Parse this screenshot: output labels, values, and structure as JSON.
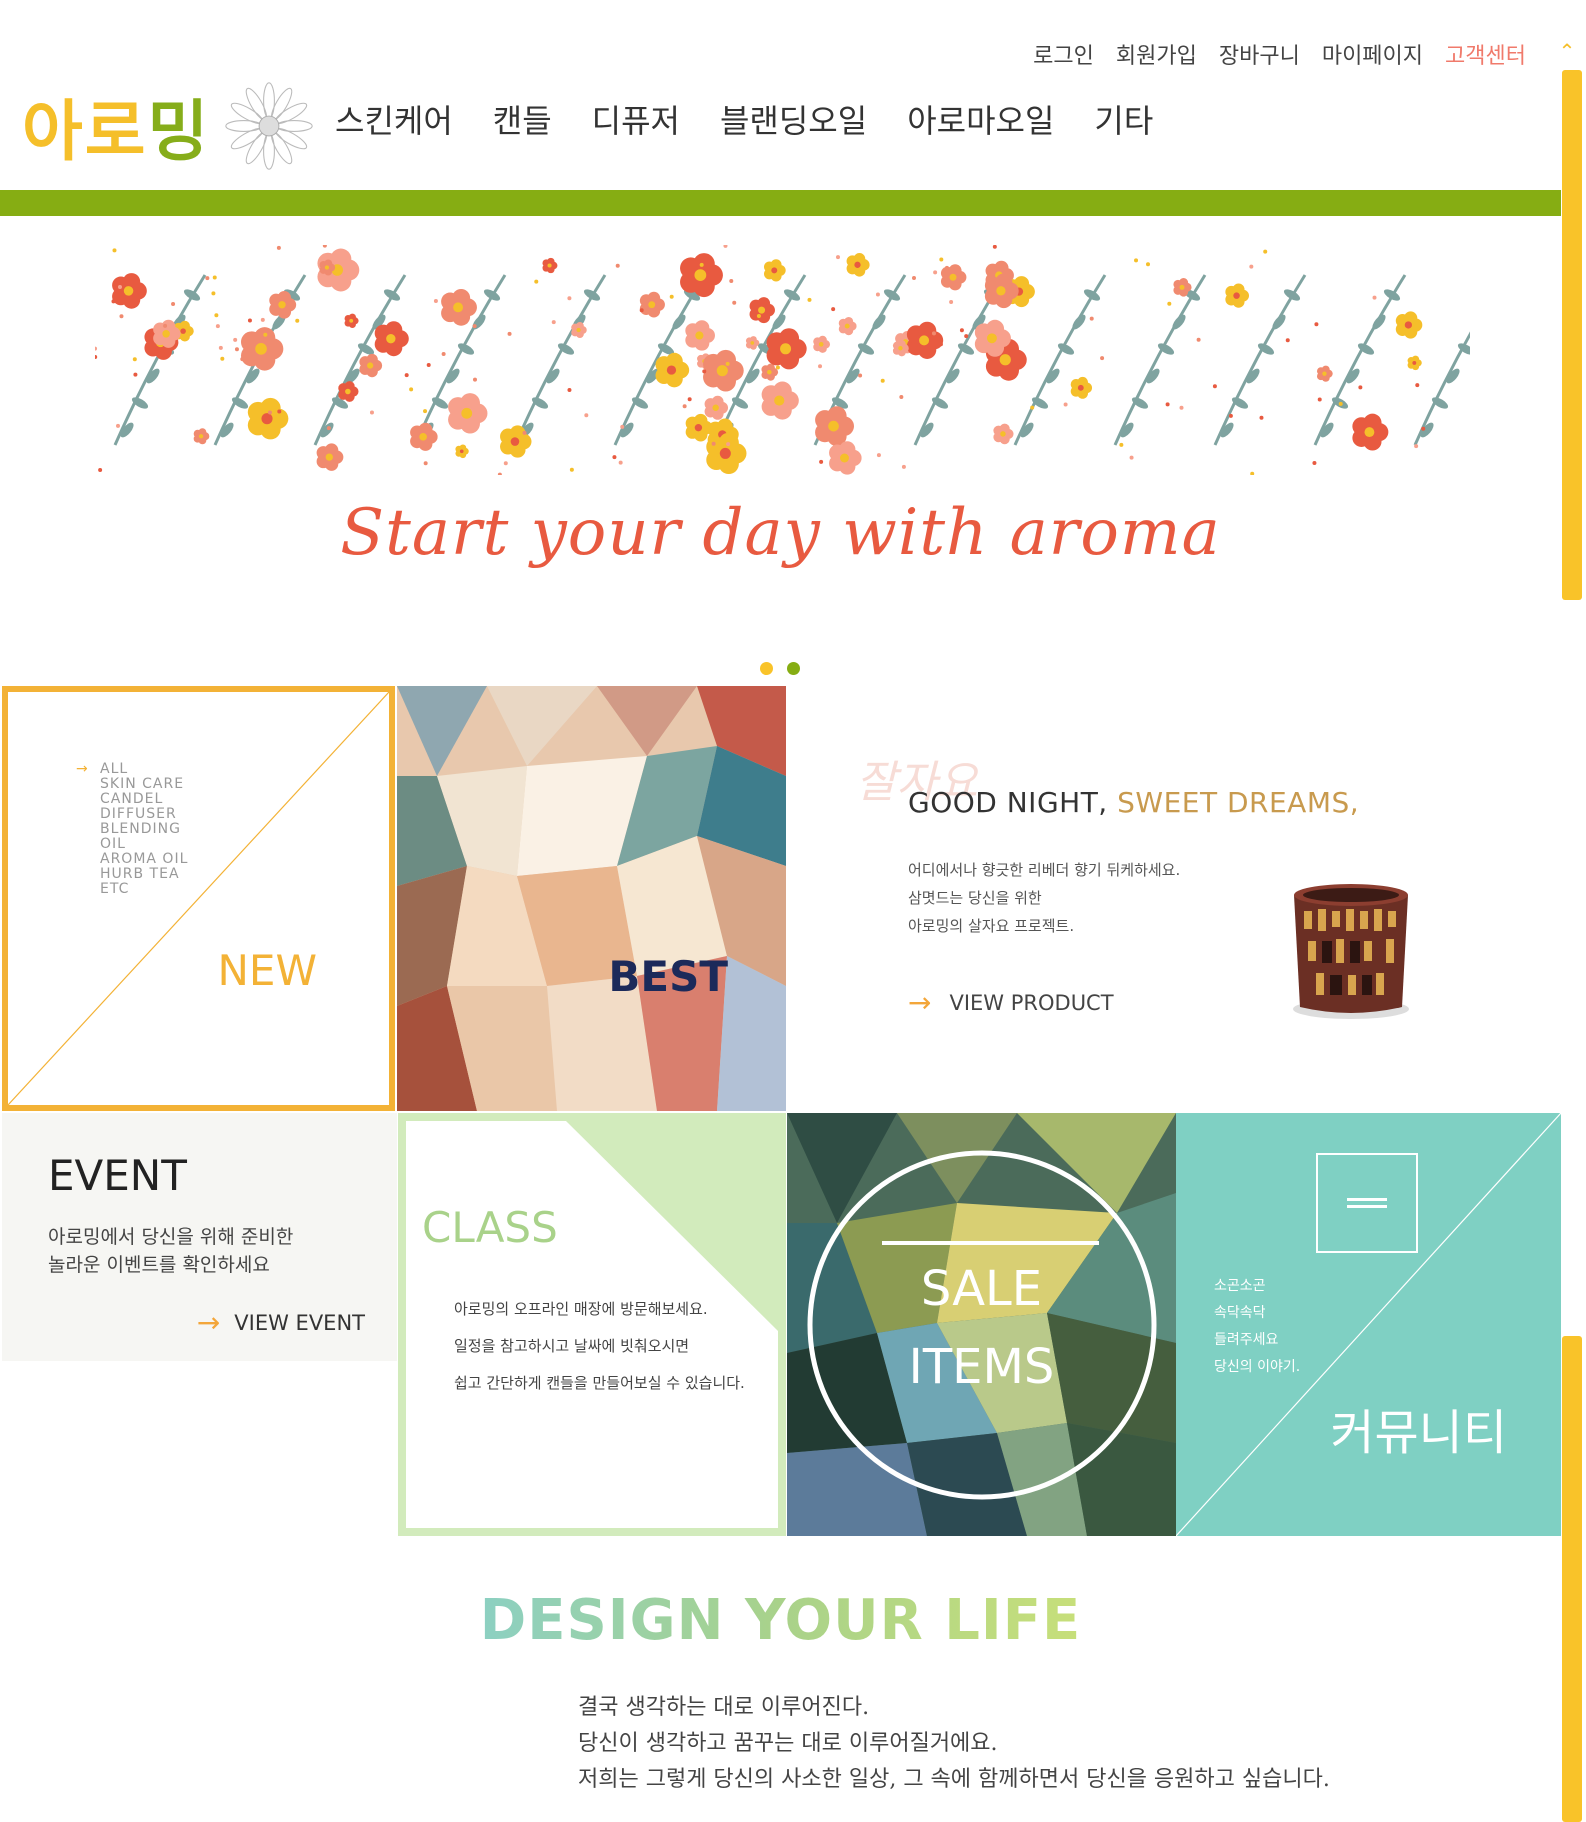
{
  "util_nav": {
    "login": "로그인",
    "signup": "회원가입",
    "cart": "장바구니",
    "mypage": "마이페이지",
    "support": "고객센터"
  },
  "logo": {
    "c1": "아",
    "c2": "로",
    "c3": "밍"
  },
  "main_nav": [
    "스킨케어",
    "캔들",
    "디퓨저",
    "블랜딩오일",
    "아로마오일",
    "기타"
  ],
  "banner": {
    "tagline": "Start your day with aroma"
  },
  "tiles": {
    "new": {
      "label": "NEW",
      "categories": [
        "ALL",
        "SKIN CARE",
        "CANDEL",
        "DIFFUSER",
        "BLENDING",
        "OIL",
        "AROMA OIL",
        "HURB TEA",
        "ETC"
      ]
    },
    "best": {
      "label": "BEST"
    },
    "night": {
      "title_a": "GOOD NIGHT,",
      "title_b": "SWEET DREAMS,",
      "script": "잘자요",
      "lines": [
        "어디에서나 향긋한 리베더 향기 뒤케하세요.",
        "삼몃드는 당신을 위한",
        "아로밍의 살자요 프로젝트."
      ],
      "link": "VIEW PRODUCT"
    },
    "event": {
      "title": "EVENT",
      "lines": [
        "아로밍에서 당신을 위해 준비한",
        "놀라운 이벤트를 확인하세요"
      ],
      "link": "VIEW EVENT"
    },
    "class": {
      "title": "CLASS",
      "lines": [
        "아로밍의 오프라인 매장에 방문해보세요.",
        "일정을 참고하시고 날싸에 빗춰오시면",
        "쉽고 간단하게 캔들을 만들어보실 수 있습니다."
      ]
    },
    "sale": {
      "line1": "SALE",
      "line2": "ITEMS"
    },
    "community": {
      "lines": [
        "소곤소곤",
        "속닥속닥",
        "들려주세요",
        "당신의 이야기."
      ],
      "label": "커뮤니티"
    }
  },
  "design": {
    "title": "DESIGN YOUR LIFE",
    "lines": [
      "결국 생각하는 대로 이루어진다.",
      "당신이 생각하고 꿈꾸는 대로 이루어질거에요.",
      "저희는 그렇게 당신의 사소한 일상, 그 속에 함께하면서 당신을 응원하고 싶습니다."
    ]
  },
  "colors": {
    "brand_green": "#86ad13",
    "brand_yellow": "#f9c329",
    "accent_coral": "#e85a40",
    "mint": "#7fd0c3"
  }
}
